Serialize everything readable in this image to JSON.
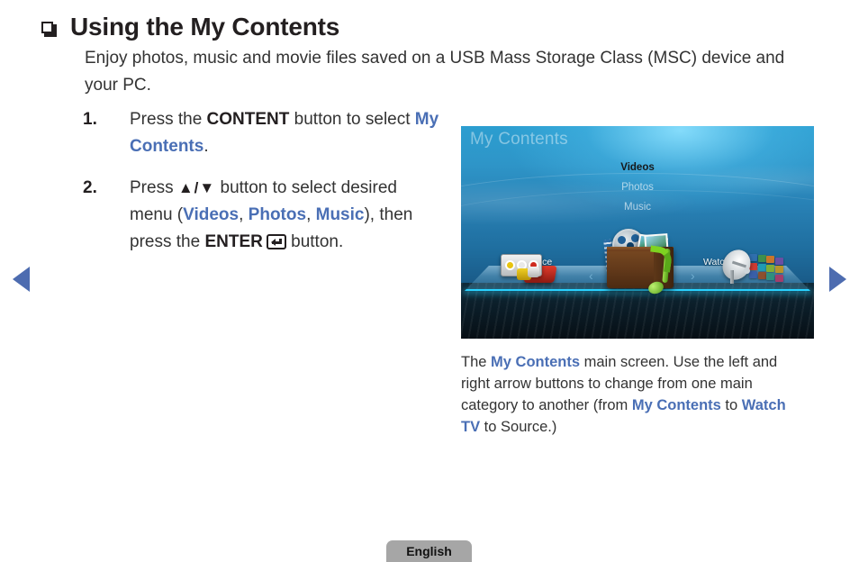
{
  "heading": {
    "bullet_icon": "shadow-box-bullet-icon",
    "title": "Using the My Contents"
  },
  "intro": {
    "text": "Enjoy photos, music and movie files saved on a USB Mass Storage Class (MSC) device and your PC."
  },
  "steps": [
    {
      "number": "1.",
      "parts": {
        "p1": "Press the ",
        "bold1": "CONTENT",
        "p2": " button to select ",
        "blue1": "My Contents",
        "p3": "."
      }
    },
    {
      "number": "2.",
      "parts": {
        "p1": "Press ",
        "updown": "▲/▼",
        "p2": " button to select desired menu (",
        "blue1": "Videos",
        "p3": ", ",
        "blue2": "Photos",
        "p4": ", ",
        "blue3": "Music",
        "p5": "), then press the ",
        "bold1": "ENTER",
        "enter_icon": "enter-key-icon",
        "p6": " button."
      }
    }
  ],
  "nav": {
    "prev_icon": "left-triangle-arrow-icon",
    "next_icon": "right-triangle-arrow-icon",
    "arrow_color": "#4d6cb0"
  },
  "tv_screen": {
    "title": "My Contents",
    "menu": [
      {
        "label": "Videos",
        "selected": true
      },
      {
        "label": "Photos",
        "selected": false
      },
      {
        "label": "Music",
        "selected": false
      }
    ],
    "left_label": "Source",
    "right_label": "Watch TV",
    "chevron_left": "‹",
    "chevron_right": "›",
    "icons": {
      "left": "rca-composite-cable-icon",
      "center": "media-box-icon",
      "right": "satellite-dish-tv-icon"
    },
    "accent_color": "#29d2ff"
  },
  "caption": {
    "p1": "The ",
    "blue1": "My Contents",
    "p2": " main screen. Use the left and right arrow buttons to change from one main category to another (from ",
    "blue2": "My Contents",
    "p3": " to ",
    "blue3": "Watch TV",
    "p4": " to Source.)"
  },
  "footer": {
    "label": "English"
  },
  "colors": {
    "accent_blue": "#4a6fb5",
    "text": "#333333",
    "footer_bg": "#a6a6a6"
  }
}
